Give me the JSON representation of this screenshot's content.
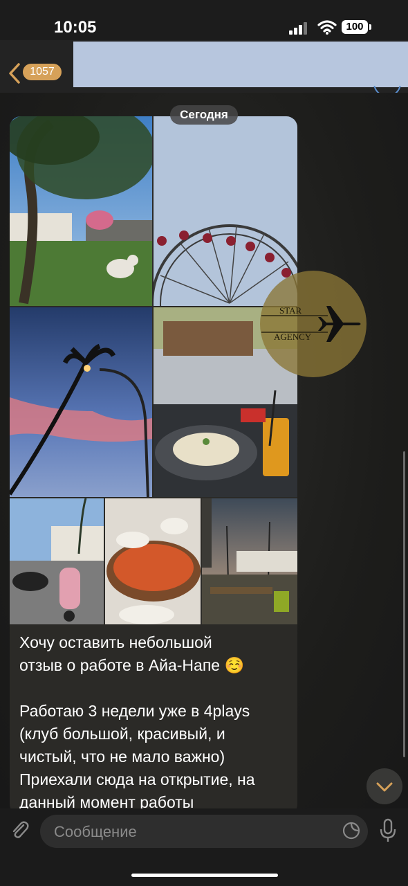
{
  "status": {
    "time": "10:05",
    "battery": "100"
  },
  "header": {
    "unread_count": "1057"
  },
  "chat": {
    "date_label": "Сегодня",
    "watermark": {
      "line1": "STAR",
      "line2": "AGENCY"
    },
    "message": {
      "text": "Хочу оставить небольшой\nотзыв о работе в Айа-Напе ☺️\n\nРаботаю 3 недели уже в 4plays\n(клуб большой, красивый, и\nчистый, что не мало важно)\nПриехали сюда на открытие, на\nданный момент работы"
    }
  },
  "composer": {
    "placeholder": "Сообщение"
  },
  "colors": {
    "accent": "#d6a159",
    "bubble": "#2b2a27",
    "header": "#232323"
  }
}
